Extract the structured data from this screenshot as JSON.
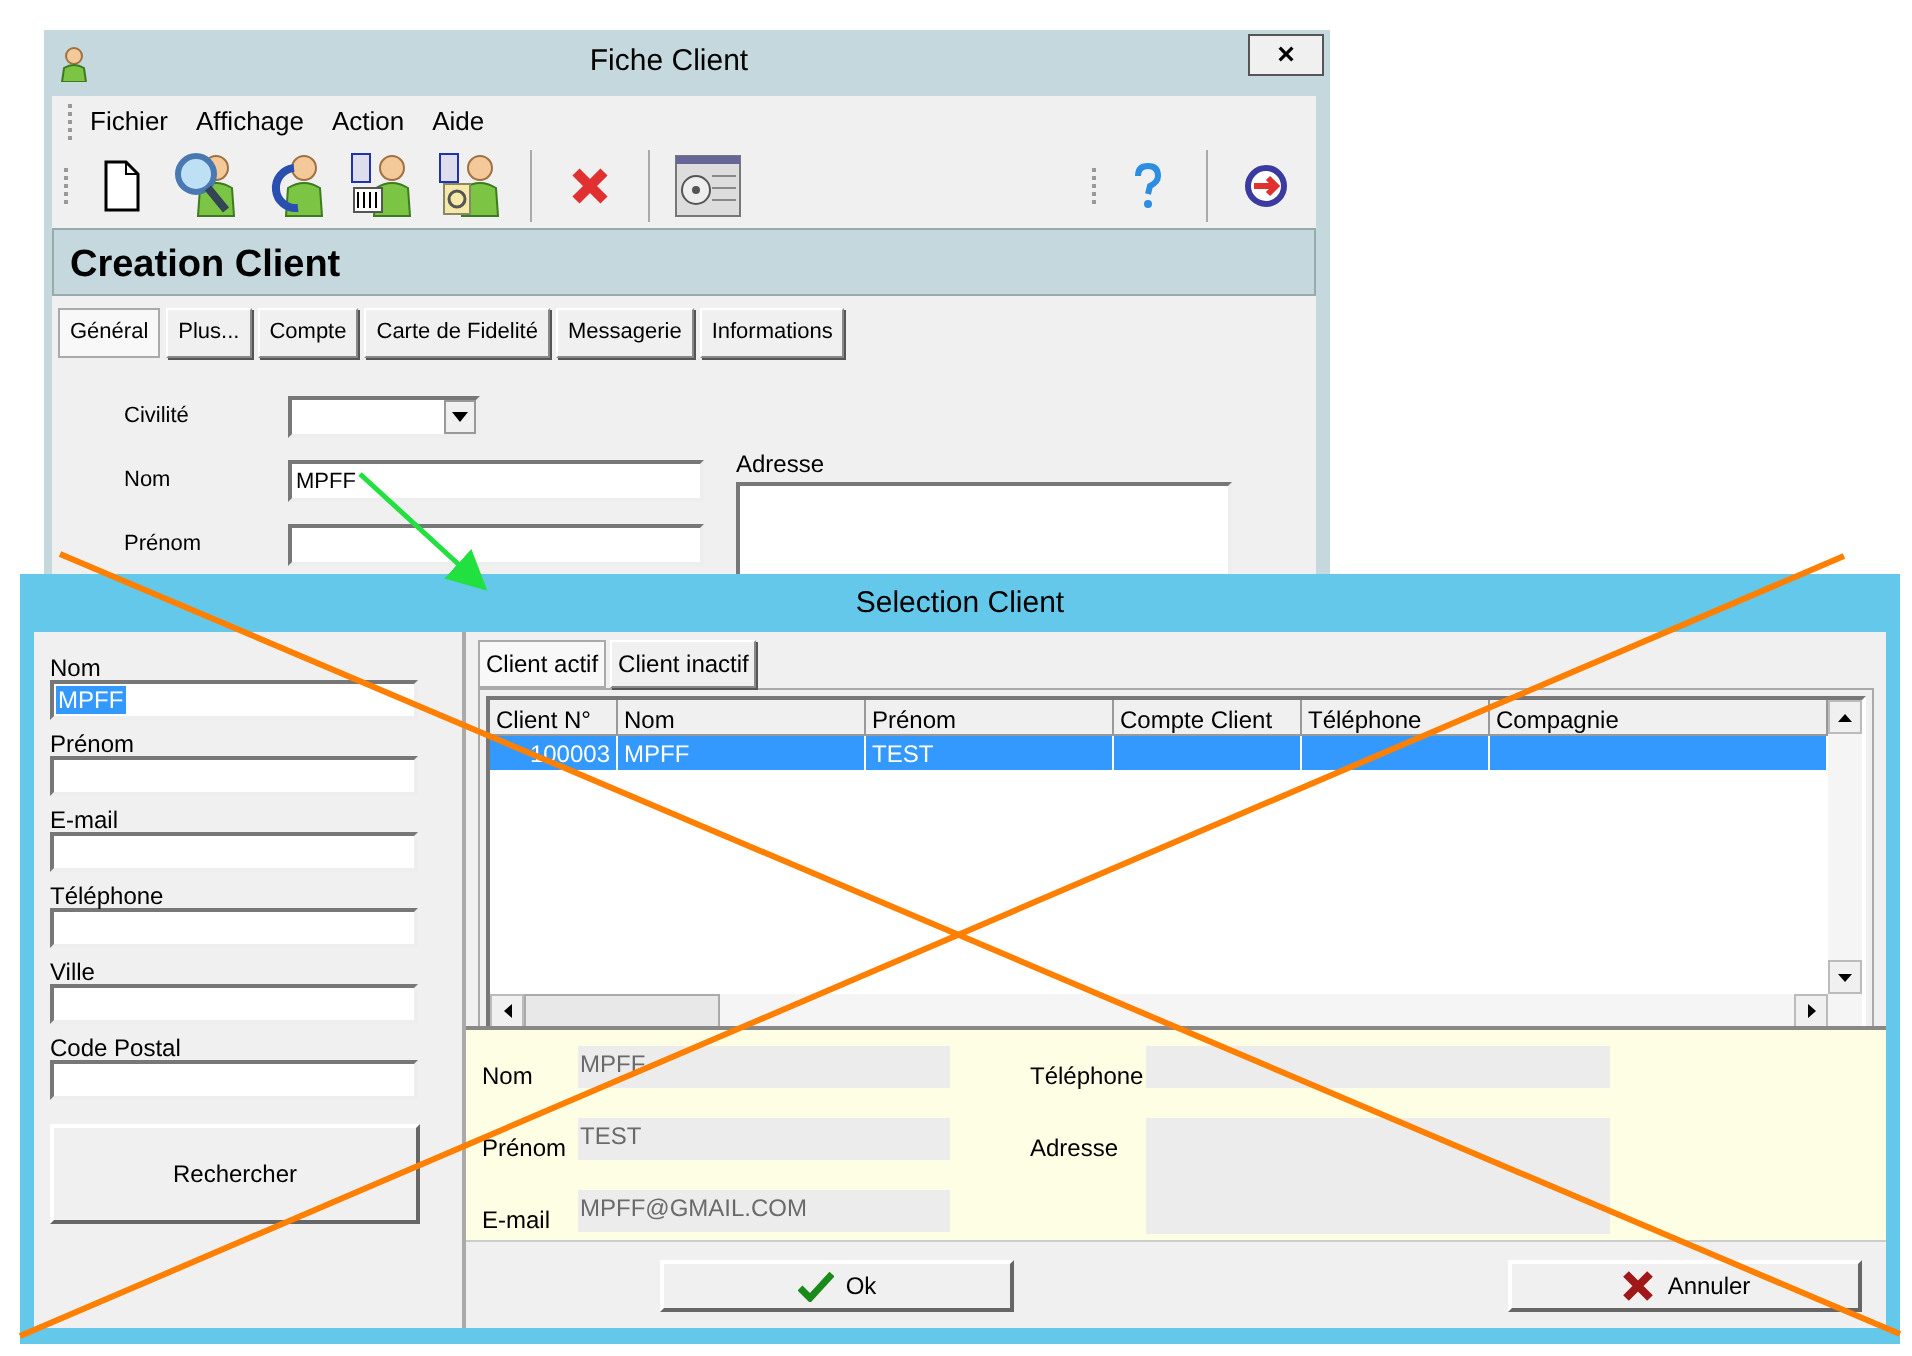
{
  "back_window": {
    "title": "Fiche Client",
    "close": "×",
    "menu": [
      "Fichier",
      "Affichage",
      "Action",
      "Aide"
    ],
    "heading": "Creation Client",
    "tabs": [
      {
        "label": "Général",
        "selected": true
      },
      {
        "label": "Plus...",
        "selected": false
      },
      {
        "label": "Compte",
        "selected": false
      },
      {
        "label": "Carte de Fidelité",
        "selected": false
      },
      {
        "label": "Messagerie",
        "selected": false
      },
      {
        "label": "Informations",
        "selected": false
      }
    ],
    "fields": [
      {
        "kind": "select",
        "label": "Civilité"
      },
      {
        "kind": "text",
        "label": "Nom",
        "value": "MPFF"
      },
      {
        "kind": "text",
        "label": "Prénom"
      }
    ],
    "address": {
      "label": "Adresse"
    }
  },
  "front_window": {
    "title": "Selection Client",
    "search_fields": [
      {
        "label": "Nom",
        "value": "MPFF",
        "highlighted": true
      },
      {
        "label": "Prénom",
        "highlighted": false
      },
      {
        "label": "E-mail",
        "highlighted": false
      },
      {
        "label": "Téléphone",
        "highlighted": false
      },
      {
        "label": "Ville",
        "highlighted": false
      },
      {
        "label": "Code Postal",
        "highlighted": false
      }
    ],
    "search_button": "Rechercher",
    "tabs": [
      {
        "label": "Client actif",
        "selected": true
      },
      {
        "label": "Client inactif",
        "selected": false
      }
    ],
    "table": {
      "columns": [
        "Client N°",
        "Nom",
        "Prénom",
        "Compte Client",
        "Téléphone",
        "Compagnie"
      ],
      "rows": [
        {
          "cells": [
            "100003",
            "MPFF",
            "TEST",
            "",
            "",
            ""
          ],
          "selected": true
        }
      ]
    },
    "details_left": [
      {
        "label": "Nom",
        "value": "MPFF"
      },
      {
        "label": "Prénom",
        "value": "TEST"
      },
      {
        "label": "E-mail",
        "value": "MPFF@GMAIL.COM"
      }
    ],
    "details_right": [
      {
        "label": "Téléphone"
      },
      {
        "label": "Adresse"
      }
    ],
    "buttons": [
      {
        "kind": "ok",
        "label": "Ok"
      },
      {
        "kind": "cancel",
        "label": "Annuler"
      }
    ]
  }
}
